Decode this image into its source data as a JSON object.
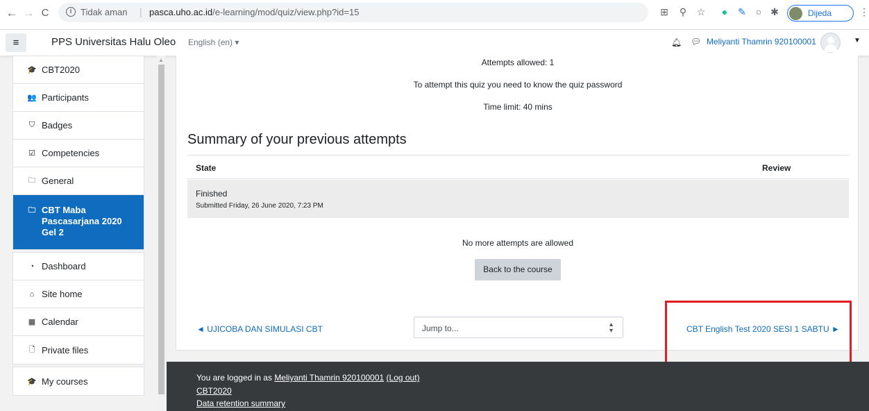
{
  "browser": {
    "back_icon": "←",
    "forward_icon": "→",
    "reload_icon": "C",
    "security_label": "Tidak aman",
    "url_host": "pasca.uho.ac.id",
    "url_path": "/e-learning/mod/quiz/view.php?id=15",
    "profile_name": "Dijeda"
  },
  "navbar": {
    "menu_icon": "≡",
    "site_name": "PPS Universitas Halu Oleo",
    "language": "English (en) ▾",
    "user_name": "Meliyanti Thamrin 920100001"
  },
  "sidebar": {
    "group1": [
      {
        "label": "CBT2020",
        "icon": "graduation-cap-icon",
        "glyph": "🎓"
      },
      {
        "label": "Participants",
        "icon": "users-icon",
        "glyph": "👥"
      },
      {
        "label": "Badges",
        "icon": "shield-icon",
        "glyph": "⛉"
      },
      {
        "label": "Competencies",
        "icon": "checkbox-icon",
        "glyph": "☑"
      },
      {
        "label": "General",
        "icon": "folder-icon",
        "glyph": "🗀"
      },
      {
        "label": "CBT Maba Pascasarjana 2020 Gel 2",
        "icon": "folder-icon",
        "glyph": "🗀"
      }
    ],
    "group2": [
      {
        "label": "Dashboard",
        "icon": "tachometer-icon",
        "glyph": "◔"
      },
      {
        "label": "Site home",
        "icon": "home-icon",
        "glyph": "⌂"
      },
      {
        "label": "Calendar",
        "icon": "calendar-icon",
        "glyph": "▦"
      },
      {
        "label": "Private files",
        "icon": "file-icon",
        "glyph": "🗋"
      }
    ],
    "group3": [
      {
        "label": "My courses",
        "icon": "graduation-cap-icon",
        "glyph": "🎓"
      }
    ]
  },
  "quiz": {
    "attempts_allowed": "Attempts allowed: 1",
    "password_note": "To attempt this quiz you need to know the quiz password",
    "time_limit": "Time limit: 40 mins",
    "summary_title": "Summary of your previous attempts",
    "table": {
      "headers": {
        "state": "State",
        "review": "Review"
      },
      "rows": [
        {
          "state": "Finished",
          "submitted": "Submitted Friday, 26 June 2020, 7:23 PM"
        }
      ]
    },
    "no_more_attempts": "No more attempts are allowed",
    "back_button": "Back to the course"
  },
  "activity_nav": {
    "prev_link": "◄ UJICOBA DAN SIMULASI CBT",
    "jump_to": "Jump to...",
    "next_link": "CBT English Test 2020 SESI 1 SABTU ►"
  },
  "footer": {
    "logged_in_prefix": "You are logged in as ",
    "logged_in_user": "Meliyanti Thamrin 920100001",
    "logout": "(Log out)",
    "course_link": "CBT2020",
    "retention_link": "Data retention summary"
  },
  "colors": {
    "brand": "#0f6cbf",
    "highlight": "#e51b23",
    "footer_bg": "#373a3c"
  }
}
